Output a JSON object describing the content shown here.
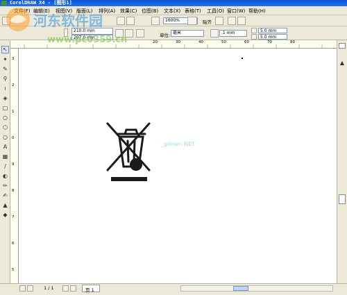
{
  "window": {
    "title": "CorelDRAW X4 - [图形1]"
  },
  "menu": [
    "文件(F)",
    "编辑(E)",
    "视图(V)",
    "版面(L)",
    "排列(A)",
    "效果(C)",
    "位图(B)",
    "文本(X)",
    "表格(T)",
    "工具(O)",
    "窗口(W)",
    "帮助(H)"
  ],
  "toolbar1": {
    "zoom": "1600%",
    "snap_label": "贴齐"
  },
  "toolbar2": {
    "width": "210.0 mm",
    "height": "297.0 mm",
    "units_label": "单位:",
    "units_value": "毫米",
    "nudge": ".1 mm",
    "dup_x": "5.0 mm",
    "dup_y": "5.0 mm"
  },
  "ruler_h": [
    "20",
    "30",
    "40",
    "50",
    "60",
    "70",
    "80"
  ],
  "ruler_v": [
    "3",
    "2",
    "1",
    "0",
    "9",
    "8",
    "7",
    "6",
    "5"
  ],
  "canvas": {
    "credit": "_gdown.NET"
  },
  "statusbar": {
    "page_count": "1 / 1",
    "page_tab": "页 1"
  },
  "watermark": {
    "text": "河东软件园",
    "url": "www.pc0359.cn"
  },
  "colors": {
    "title_bar": "#0a53d8",
    "chrome": "#ece9d8",
    "canvas": "#ffffff"
  }
}
